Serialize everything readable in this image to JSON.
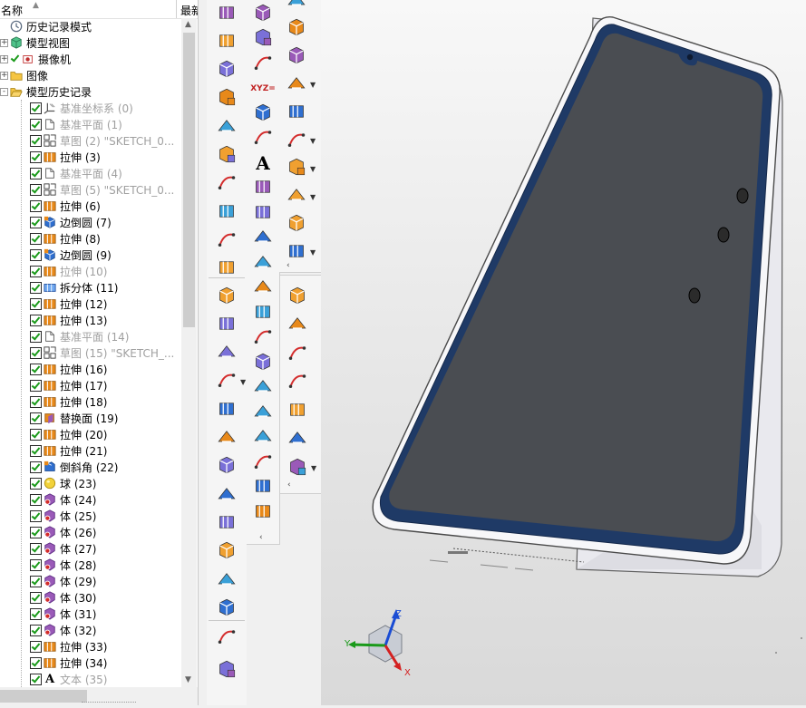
{
  "navigator": {
    "header": {
      "col_name": "名称",
      "sort_arrow": "▲",
      "col_recent": "最新"
    },
    "items": [
      {
        "label": "历史记录模式",
        "icon": "clock-icon",
        "dim": false,
        "checked": false,
        "expander": "",
        "indent": 0
      },
      {
        "label": "模型视图",
        "icon": "model-views-icon",
        "dim": false,
        "checked": false,
        "expander": "+",
        "indent": 0
      },
      {
        "label": "摄像机",
        "icon": "camera-icon",
        "dim": false,
        "checked": true,
        "expander": "+",
        "indent": 0
      },
      {
        "label": "图像",
        "icon": "folder-icon",
        "dim": false,
        "checked": false,
        "expander": "+",
        "indent": 0
      },
      {
        "label": "模型历史记录",
        "icon": "folder-open-icon",
        "dim": false,
        "checked": false,
        "expander": "-",
        "indent": 0
      },
      {
        "label": "基准坐标系 (0)",
        "icon": "csys-icon",
        "dim": true,
        "checked": true,
        "expander": "",
        "indent": 1
      },
      {
        "label": "基准平面 (1)",
        "icon": "datum-plane-icon",
        "dim": true,
        "checked": true,
        "expander": "",
        "indent": 1
      },
      {
        "label": "草图 (2) \"SKETCH_0...",
        "icon": "sketch-icon",
        "dim": true,
        "checked": true,
        "expander": "",
        "indent": 1
      },
      {
        "label": "拉伸 (3)",
        "icon": "extrude-icon",
        "dim": false,
        "checked": true,
        "expander": "",
        "indent": 1
      },
      {
        "label": "基准平面 (4)",
        "icon": "datum-plane-icon",
        "dim": true,
        "checked": true,
        "expander": "",
        "indent": 1
      },
      {
        "label": "草图 (5) \"SKETCH_0...",
        "icon": "sketch-icon",
        "dim": true,
        "checked": true,
        "expander": "",
        "indent": 1
      },
      {
        "label": "拉伸 (6)",
        "icon": "extrude-icon",
        "dim": false,
        "checked": true,
        "expander": "",
        "indent": 1
      },
      {
        "label": "边倒圆 (7)",
        "icon": "edge-blend-icon",
        "dim": false,
        "checked": true,
        "expander": "",
        "indent": 1
      },
      {
        "label": "拉伸 (8)",
        "icon": "extrude-icon",
        "dim": false,
        "checked": true,
        "expander": "",
        "indent": 1
      },
      {
        "label": "边倒圆 (9)",
        "icon": "edge-blend-icon",
        "dim": false,
        "checked": true,
        "expander": "",
        "indent": 1
      },
      {
        "label": "拉伸 (10)",
        "icon": "extrude-icon",
        "dim": true,
        "checked": true,
        "expander": "",
        "indent": 1
      },
      {
        "label": "拆分体 (11)",
        "icon": "split-body-icon",
        "dim": false,
        "checked": true,
        "expander": "",
        "indent": 1
      },
      {
        "label": "拉伸 (12)",
        "icon": "extrude-icon",
        "dim": false,
        "checked": true,
        "expander": "",
        "indent": 1
      },
      {
        "label": "拉伸 (13)",
        "icon": "extrude-icon",
        "dim": false,
        "checked": true,
        "expander": "",
        "indent": 1
      },
      {
        "label": "基准平面 (14)",
        "icon": "datum-plane-icon",
        "dim": true,
        "checked": true,
        "expander": "",
        "indent": 1
      },
      {
        "label": "草图 (15) \"SKETCH_...",
        "icon": "sketch-icon",
        "dim": true,
        "checked": true,
        "expander": "",
        "indent": 1
      },
      {
        "label": "拉伸 (16)",
        "icon": "extrude-icon",
        "dim": false,
        "checked": true,
        "expander": "",
        "indent": 1
      },
      {
        "label": "拉伸 (17)",
        "icon": "extrude-icon",
        "dim": false,
        "checked": true,
        "expander": "",
        "indent": 1
      },
      {
        "label": "拉伸 (18)",
        "icon": "extrude-icon",
        "dim": false,
        "checked": true,
        "expander": "",
        "indent": 1
      },
      {
        "label": "替换面 (19)",
        "icon": "replace-face-icon",
        "dim": false,
        "checked": true,
        "expander": "",
        "indent": 1
      },
      {
        "label": "拉伸 (20)",
        "icon": "extrude-icon",
        "dim": false,
        "checked": true,
        "expander": "",
        "indent": 1
      },
      {
        "label": "拉伸 (21)",
        "icon": "extrude-icon",
        "dim": false,
        "checked": true,
        "expander": "",
        "indent": 1
      },
      {
        "label": "倒斜角 (22)",
        "icon": "chamfer-icon",
        "dim": false,
        "checked": true,
        "expander": "",
        "indent": 1
      },
      {
        "label": "球 (23)",
        "icon": "sphere-icon",
        "dim": false,
        "checked": true,
        "expander": "",
        "indent": 1
      },
      {
        "label": "体 (24)",
        "icon": "body-icon",
        "dim": false,
        "checked": true,
        "expander": "",
        "indent": 1
      },
      {
        "label": "体 (25)",
        "icon": "body-icon",
        "dim": false,
        "checked": true,
        "expander": "",
        "indent": 1
      },
      {
        "label": "体 (26)",
        "icon": "body-icon",
        "dim": false,
        "checked": true,
        "expander": "",
        "indent": 1
      },
      {
        "label": "体 (27)",
        "icon": "body-icon",
        "dim": false,
        "checked": true,
        "expander": "",
        "indent": 1
      },
      {
        "label": "体 (28)",
        "icon": "body-icon",
        "dim": false,
        "checked": true,
        "expander": "",
        "indent": 1
      },
      {
        "label": "体 (29)",
        "icon": "body-icon",
        "dim": false,
        "checked": true,
        "expander": "",
        "indent": 1
      },
      {
        "label": "体 (30)",
        "icon": "body-icon",
        "dim": false,
        "checked": true,
        "expander": "",
        "indent": 1
      },
      {
        "label": "体 (31)",
        "icon": "body-icon",
        "dim": false,
        "checked": true,
        "expander": "",
        "indent": 1
      },
      {
        "label": "体 (32)",
        "icon": "body-icon",
        "dim": false,
        "checked": true,
        "expander": "",
        "indent": 1
      },
      {
        "label": "拉伸 (33)",
        "icon": "extrude-icon",
        "dim": false,
        "checked": true,
        "expander": "",
        "indent": 1
      },
      {
        "label": "拉伸 (34)",
        "icon": "extrude-icon",
        "dim": false,
        "checked": true,
        "expander": "",
        "indent": 1
      },
      {
        "label": "文本 (35)",
        "icon": "text-icon",
        "dim": true,
        "checked": true,
        "expander": "",
        "indent": 1
      }
    ]
  },
  "toolbars": {
    "col1": [
      "extrude-tool-icon",
      "revolve-tool-icon",
      "block-icon",
      "cylinder-icon",
      "cone-icon",
      "sphere-tool-icon",
      "emboss-icon",
      "offset-face-icon",
      "stack-icon",
      "thread-icon",
      "lattice-icon",
      "pattern-feature-icon",
      "unite-icon",
      "boolean-icon",
      "book-icon",
      "shell-icon",
      "draft-icon",
      "trim-body-icon",
      "swept-icon",
      "thicken-icon",
      "blend-icon",
      "rotate-face-icon",
      "box-icon",
      "sew-icon"
    ],
    "col2": [
      "arc-icon",
      "point-set-icon",
      "rectangle-icon",
      "xyz-text-icon",
      "spline-icon",
      "polygon-points-icon",
      "text-A-icon",
      "fillet-curve-icon",
      "offset-curve-icon",
      "bridge-curve-icon",
      "project-curve-icon",
      "join-curve-icon",
      "intersect-curve-icon",
      "offset-in-face-icon",
      "isoparametric-icon",
      "divide-curve-icon",
      "extract-curve-icon",
      "section-curve-icon",
      "wrap-curve-icon",
      "mesh-surface-icon",
      "cylinder-arrow-icon"
    ],
    "col3": [
      "red-arrow-curve-icon",
      "cube-plus-icon",
      "cube-triangle-icon",
      "cube-x-icon",
      "cube-copy-icon",
      "cube-split-icon",
      "cube-scale-icon",
      "cube-measure-icon",
      "cube-delta-icon",
      "cube-move-icon"
    ],
    "col3b": [
      "surface-grid-icon",
      "surface-patch-icon",
      "surface-trim-icon",
      "surface-blend-icon",
      "surface-analysis-icon",
      "surface-fit-icon",
      "surface-sweep-icon"
    ],
    "more_chevron": "‹",
    "xyz_label": "XYZ=",
    "text_A_label": "A"
  },
  "viewport": {
    "model": "phone-model",
    "triad": {
      "x_label": "X",
      "y_label": "Y",
      "z_label": "Z"
    }
  }
}
